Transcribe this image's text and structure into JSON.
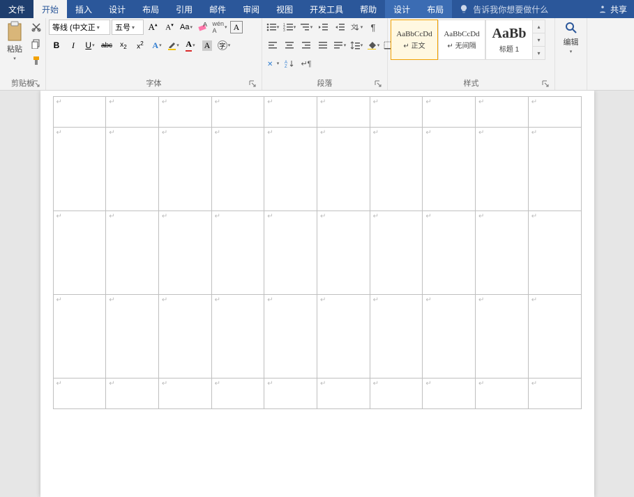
{
  "tabs": {
    "file": "文件",
    "home": "开始",
    "insert": "插入",
    "design": "设计",
    "layout": "布局",
    "references": "引用",
    "mail": "邮件",
    "review": "审阅",
    "view": "视图",
    "dev": "开发工具",
    "help": "帮助",
    "tdesign": "设计",
    "tlayout": "布局"
  },
  "tellme": "告诉我你想要做什么",
  "share": "共享",
  "clipboard": {
    "paste": "粘贴",
    "label": "剪贴板"
  },
  "font": {
    "name": "等线 (中文正",
    "size": "五号",
    "bold": "B",
    "italic": "I",
    "underline": "U",
    "strike": "abc",
    "sub": "x₂",
    "sup": "x²",
    "label": "字体"
  },
  "para": {
    "label": "段落"
  },
  "styles": {
    "items": [
      {
        "preview": "AaBbCcDd",
        "label": "↵ 正文"
      },
      {
        "preview": "AaBbCcDd",
        "label": "↵ 无间隔"
      },
      {
        "preview": "AaBb",
        "label": "标题 1"
      }
    ],
    "label": "样式"
  },
  "edit": {
    "label": "编辑"
  },
  "table": {
    "cols": 10,
    "rows": [
      {
        "type": "short"
      },
      {
        "type": "tall"
      },
      {
        "type": "tall"
      },
      {
        "type": "tall"
      },
      {
        "type": "short"
      }
    ]
  }
}
